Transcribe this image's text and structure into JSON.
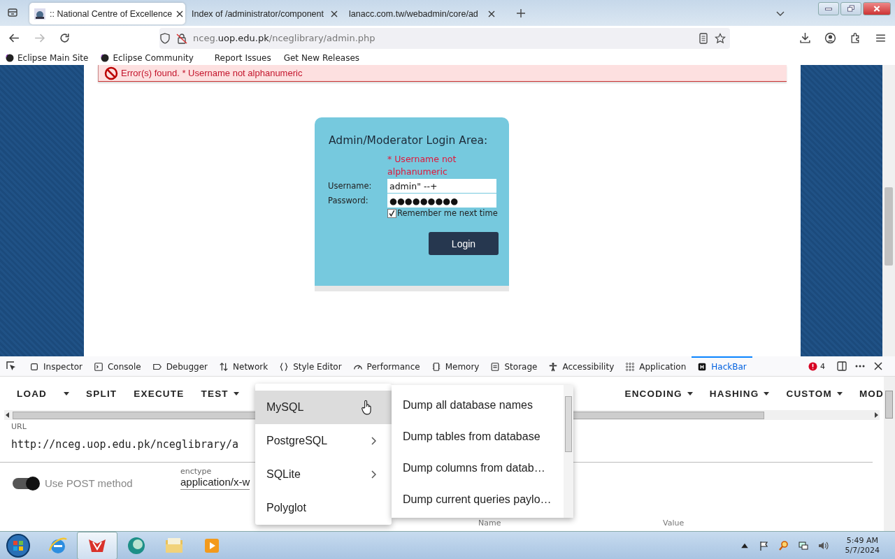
{
  "browser": {
    "tabs": [
      {
        "title": ":: National Centre of Excellence",
        "selected": true
      },
      {
        "title": "Index of /administrator/component",
        "selected": false
      },
      {
        "title": "lanacc.com.tw/webadmin/core/ad",
        "selected": false
      }
    ],
    "address": {
      "prefix": "nceg.",
      "host": "uop.edu.pk",
      "path": "/nceglibrary/admin.php"
    },
    "bookmarks": [
      {
        "label": "Eclipse Main Site",
        "kind": "icon"
      },
      {
        "label": "Eclipse Community",
        "kind": "icon"
      },
      {
        "label": "Report Issues",
        "kind": "plain"
      },
      {
        "label": "Get New Releases",
        "kind": "plain"
      }
    ]
  },
  "page": {
    "error_banner": "Error(s) found. * Username not alphanumeric",
    "login": {
      "title": "Admin/Moderator Login Area:",
      "error": "* Username not alphanumeric",
      "username_label": "Username:",
      "username": "admin\" --+",
      "password_label": "Password:",
      "password": "●●●●●●●●●",
      "remember": {
        "label": "Remember me next time",
        "checked": true
      },
      "button": "Login"
    }
  },
  "devtools": {
    "tabs": [
      {
        "label": "Inspector",
        "selected": false
      },
      {
        "label": "Console",
        "selected": false
      },
      {
        "label": "Debugger",
        "selected": false
      },
      {
        "label": "Network",
        "selected": false
      },
      {
        "label": "Style Editor",
        "selected": false
      },
      {
        "label": "Performance",
        "selected": false
      },
      {
        "label": "Memory",
        "selected": false
      },
      {
        "label": "Storage",
        "selected": false
      },
      {
        "label": "Accessibility",
        "selected": false
      },
      {
        "label": "Application",
        "selected": false
      },
      {
        "label": "HackBar",
        "selected": true
      }
    ],
    "error_count": "4"
  },
  "hackbar": {
    "toolbar_left": [
      {
        "label": "LOAD",
        "dropdown": true
      },
      {
        "label": "SPLIT",
        "dropdown": false
      },
      {
        "label": "EXECUTE",
        "dropdown": false
      },
      {
        "label": "TEST",
        "dropdown": true
      }
    ],
    "toolbar_right": [
      {
        "label": "ENCODING",
        "dropdown": true
      },
      {
        "label": "HASHING",
        "dropdown": true
      },
      {
        "label": "CUSTOM",
        "dropdown": true
      },
      {
        "label": "MOD",
        "dropdown": false
      }
    ],
    "url_label": "URL",
    "url": "http://nceg.uop.edu.pk/nceglibrary/a",
    "post": {
      "label": "Use POST method",
      "on": true
    },
    "enctype_label": "enctype",
    "enctype": "application/x-w",
    "columns": [
      "Name",
      "Value"
    ],
    "menu": [
      {
        "label": "MySQL",
        "selected": true,
        "submenu": false
      },
      {
        "label": "PostgreSQL",
        "selected": false,
        "submenu": true
      },
      {
        "label": "SQLite",
        "selected": false,
        "submenu": true
      },
      {
        "label": "Polyglot",
        "selected": false,
        "submenu": false
      }
    ],
    "submenu": [
      "Dump all database names",
      "Dump tables from database",
      "Dump columns from datab…",
      "Dump current queries paylo…"
    ]
  },
  "taskbar": {
    "time": "5:49 AM",
    "date": "5/7/2024"
  }
}
